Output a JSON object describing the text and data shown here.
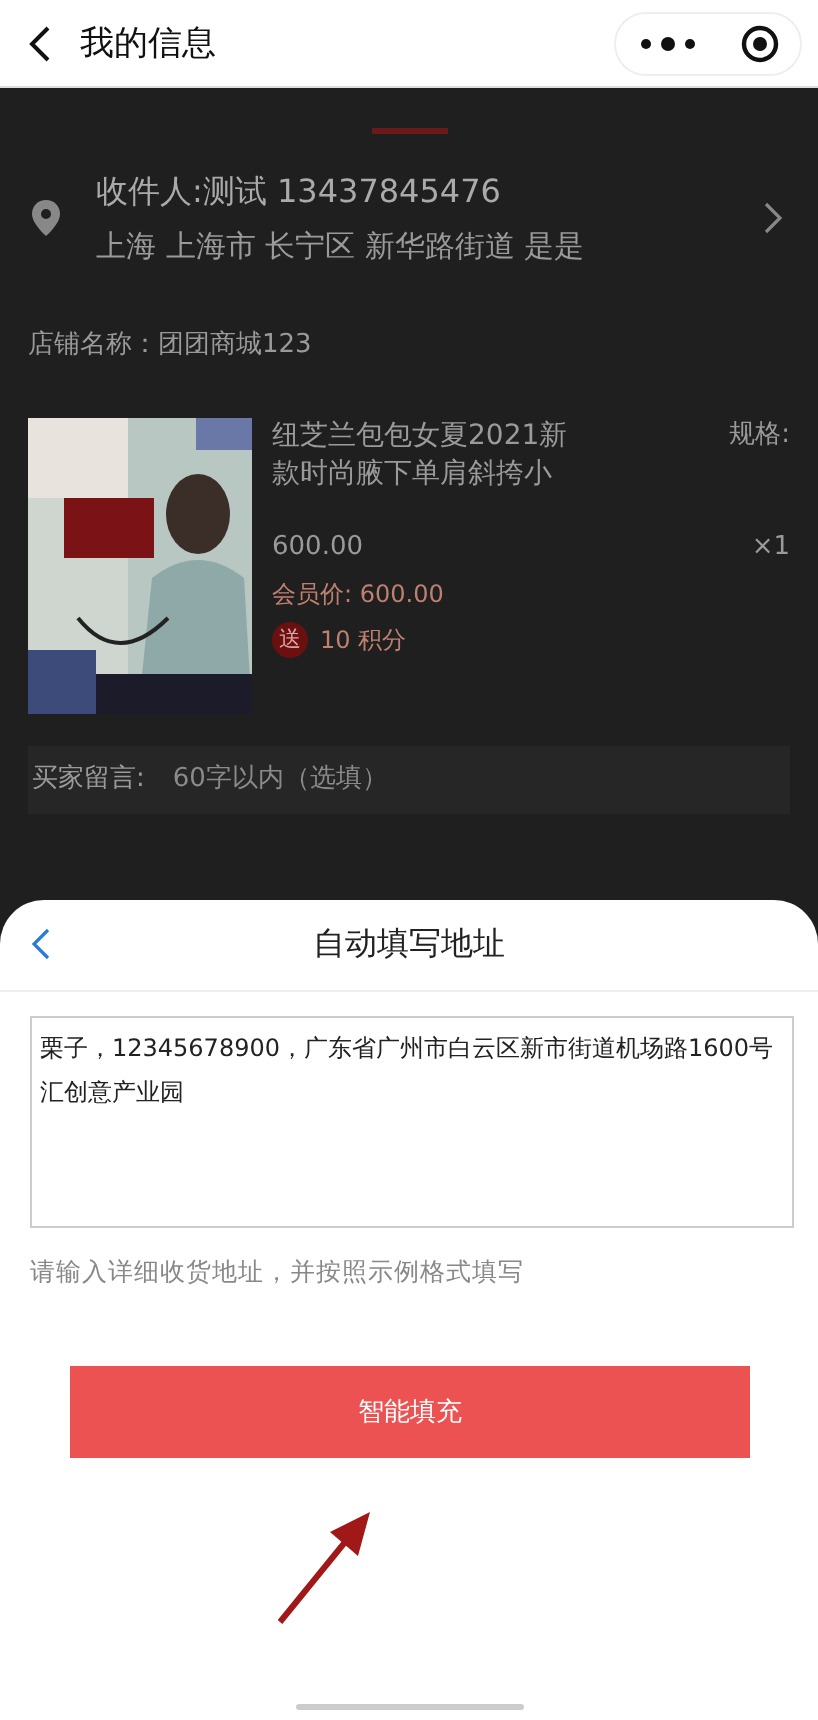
{
  "header": {
    "title": "我的信息"
  },
  "tabs": [
    {
      "selected": true
    }
  ],
  "address": {
    "recipient": "收件人:测试 13437845476",
    "detail": "上海 上海市 长宁区 新华路街道 是是"
  },
  "store": {
    "name": "店铺名称：团团商城123"
  },
  "product": {
    "title": "纽芝兰包包女夏2021新款时尚腋下单肩斜挎小",
    "spec_label": "规格:",
    "price": "600.00",
    "quantity": "×1",
    "member_price": "会员价: 600.00",
    "points_badge": "送",
    "points": "10 积分"
  },
  "message": {
    "label": "买家留言:",
    "placeholder": "60字以内（选填）"
  },
  "sheet": {
    "title": "自动填写地址",
    "address_value": "栗子，12345678900，广东省广州市白云区新市街道机场路1600号汇创意产业园",
    "hint": "请输入详细收货地址，并按照示例格式填写",
    "fill_button": "智能填充"
  }
}
